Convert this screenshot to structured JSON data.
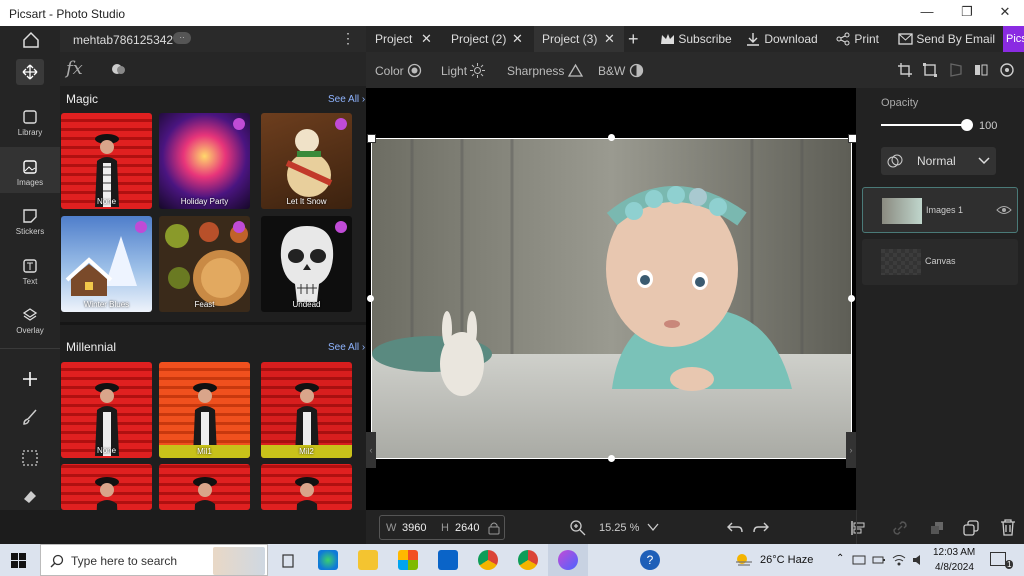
{
  "window": {
    "title": "Picsart - Photo Studio",
    "minimize": "—",
    "maximize": "❐",
    "close": "✕"
  },
  "rail": {
    "items": [
      {
        "label": "Library"
      },
      {
        "label": "Images"
      },
      {
        "label": "Stickers"
      },
      {
        "label": "Text"
      },
      {
        "label": "Overlay"
      }
    ]
  },
  "panel": {
    "username": "mehtab786125342",
    "badge": "··",
    "fx": "fx",
    "magic": {
      "title": "Magic",
      "see_all": "See All ›",
      "items": [
        {
          "label": "None"
        },
        {
          "label": "Holiday Party"
        },
        {
          "label": "Let It Snow"
        },
        {
          "label": "Winter Blues"
        },
        {
          "label": "Feast"
        },
        {
          "label": "Undead"
        }
      ]
    },
    "millennial": {
      "title": "Millennial",
      "see_all": "See All ›",
      "items": [
        {
          "label": "None"
        },
        {
          "label": "Mil1"
        },
        {
          "label": "Mil2"
        }
      ]
    }
  },
  "tabs": [
    {
      "label": "Project",
      "close": "✕"
    },
    {
      "label": "Project (2)",
      "close": "✕"
    },
    {
      "label": "Project (3)",
      "close": "✕"
    }
  ],
  "toolbar": {
    "add": "+",
    "subscribe": "Subscribe",
    "download": "Download",
    "print": "Print",
    "email": "Send By Email",
    "picsart": "Picsart"
  },
  "adjust": {
    "color": "Color",
    "light": "Light",
    "sharpness": "Sharpness",
    "bw": "B&W"
  },
  "properties": {
    "opacity_label": "Opacity",
    "opacity_value": "100",
    "opacity_fraction": 1.0,
    "blend": "Normal",
    "layers": [
      {
        "name": "Images 1"
      },
      {
        "name": "Canvas"
      }
    ]
  },
  "bottom": {
    "w_label": "W",
    "w_value": "3960",
    "h_label": "H",
    "h_value": "2640",
    "zoom": "15.25 %"
  },
  "taskbar": {
    "search_placeholder": "Type here to search",
    "weather": "26°C Haze",
    "time": "12:03 AM",
    "date": "4/8/2024",
    "notif": "1"
  },
  "colors": {
    "accent": "#8a2be2",
    "link": "#8fb4ff"
  }
}
